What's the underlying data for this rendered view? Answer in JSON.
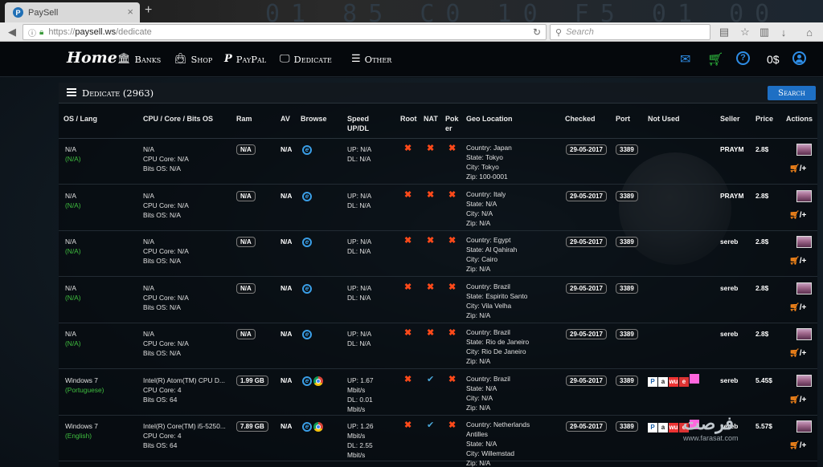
{
  "browser": {
    "tab_title": "PaySell",
    "tab_favicon": "P",
    "url_prefix": "https://",
    "url_host": "paysell.ws",
    "url_path": "/dedicate",
    "search_placeholder": "Search",
    "deco_text": "01  85  C0  10  F5  01  00  10"
  },
  "header": {
    "brand": "Home",
    "menu": [
      {
        "label": "Banks",
        "icon": "bank-icon"
      },
      {
        "label": "Shop",
        "icon": "shopping-bag-icon"
      },
      {
        "label": "PayPal",
        "icon": "paypal-icon"
      },
      {
        "label": "Dedicate",
        "icon": "monitor-icon"
      },
      {
        "label": "Other",
        "icon": "server-icon"
      }
    ],
    "balance": "0$",
    "colors": {
      "accent": "#1e6fc4",
      "mail": "#2e8de6",
      "cart": "#2fbf3f"
    }
  },
  "panel": {
    "title": "Dedicate (2963)",
    "search_button": "Search"
  },
  "table": {
    "columns": {
      "os": "OS / Lang",
      "cpu": "CPU / Core / Bits OS",
      "ram": "Ram",
      "av": "AV",
      "browse": "Browse",
      "speed1": "Speed",
      "speed2": "UP/DL",
      "root": "Root",
      "nat": "NAT",
      "poker1": "Pok",
      "poker2": "er",
      "geo": "Geo Location",
      "checked": "Checked",
      "port": "Port",
      "notused": "Not Used",
      "seller": "Seller",
      "price": "Price",
      "actions": "Actions"
    },
    "rows": [
      {
        "os": "N/A",
        "lang": "(N/A)",
        "cpu": "N/A",
        "core": "CPU Core: N/A",
        "bits": "Bits OS: N/A",
        "ram": "N/A",
        "av": "N/A",
        "up": "UP: N/A",
        "up2": "",
        "dl": "DL: N/A",
        "dl2": "",
        "nat": "x",
        "country": "Country: Japan",
        "state": "State: Tokyo",
        "city": "City: Tokyo",
        "zip": "Zip: 100-0001",
        "checked": "29-05-2017",
        "port": "3389",
        "seller": "PRAYM",
        "price": "2.8$",
        "chrome": false,
        "notused": false
      },
      {
        "os": "N/A",
        "lang": "(N/A)",
        "cpu": "N/A",
        "core": "CPU Core: N/A",
        "bits": "Bits OS: N/A",
        "ram": "N/A",
        "av": "N/A",
        "up": "UP: N/A",
        "up2": "",
        "dl": "DL: N/A",
        "dl2": "",
        "nat": "x",
        "country": "Country: Italy",
        "state": "State: N/A",
        "city": "City: N/A",
        "zip": "Zip: N/A",
        "checked": "29-05-2017",
        "port": "3389",
        "seller": "PRAYM",
        "price": "2.8$",
        "chrome": false,
        "notused": false
      },
      {
        "os": "N/A",
        "lang": "(N/A)",
        "cpu": "N/A",
        "core": "CPU Core: N/A",
        "bits": "Bits OS: N/A",
        "ram": "N/A",
        "av": "N/A",
        "up": "UP: N/A",
        "up2": "",
        "dl": "DL: N/A",
        "dl2": "",
        "nat": "x",
        "country": "Country: Egypt",
        "state": "State: Al Qahirah",
        "city": "City: Cairo",
        "zip": "Zip: N/A",
        "checked": "29-05-2017",
        "port": "3389",
        "seller": "sereb",
        "price": "2.8$",
        "chrome": false,
        "notused": false
      },
      {
        "os": "N/A",
        "lang": "(N/A)",
        "cpu": "N/A",
        "core": "CPU Core: N/A",
        "bits": "Bits OS: N/A",
        "ram": "N/A",
        "av": "N/A",
        "up": "UP: N/A",
        "up2": "",
        "dl": "DL: N/A",
        "dl2": "",
        "nat": "x",
        "country": "Country: Brazil",
        "state": "State: Espirito Santo",
        "city": "City: Vila Velha",
        "zip": "Zip: N/A",
        "checked": "29-05-2017",
        "port": "3389",
        "seller": "sereb",
        "price": "2.8$",
        "chrome": false,
        "notused": false
      },
      {
        "os": "N/A",
        "lang": "(N/A)",
        "cpu": "N/A",
        "core": "CPU Core: N/A",
        "bits": "Bits OS: N/A",
        "ram": "N/A",
        "av": "N/A",
        "up": "UP: N/A",
        "up2": "",
        "dl": "DL: N/A",
        "dl2": "",
        "nat": "x",
        "country": "Country: Brazil",
        "state": "State: Rio de Janeiro",
        "city": "City: Rio De Janeiro",
        "zip": "Zip: N/A",
        "checked": "29-05-2017",
        "port": "3389",
        "seller": "sereb",
        "price": "2.8$",
        "chrome": false,
        "notused": false
      },
      {
        "os": "Windows 7",
        "lang": "(Portuguese)",
        "cpu": "Intel(R) Atom(TM) CPU D...",
        "core": "CPU Core: 4",
        "bits": "Bits OS: 64",
        "ram": "1.99 GB",
        "av": "N/A",
        "up": "UP: 1.67",
        "up2": "Mbit/s",
        "dl": "DL: 0.01",
        "dl2": "Mbit/s",
        "nat": "check",
        "country": "Country: Brazil",
        "state": "State: N/A",
        "city": "City: N/A",
        "zip": "Zip: N/A",
        "checked": "29-05-2017",
        "port": "3389",
        "seller": "sereb",
        "price": "5.45$",
        "chrome": true,
        "notused": true
      },
      {
        "os": "Windows 7",
        "lang": "(English)",
        "cpu": "Intel(R) Core(TM) i5-5250...",
        "core": "CPU Core: 4",
        "bits": "Bits OS: 64",
        "ram": "7.89 GB",
        "av": "N/A",
        "up": "UP: 1.26",
        "up2": "Mbit/s",
        "dl": "DL: 2.55",
        "dl2": "Mbit/s",
        "nat": "check",
        "country": "Country: Netherlands",
        "state": "Antilles",
        "city": "State: N/A",
        "zip": "City: Willemstad",
        "zip2": "Zip: N/A",
        "checked": "29-05-2017",
        "port": "3389",
        "seller": "sereb",
        "price": "5.57$",
        "chrome": true,
        "notused": true
      }
    ]
  },
  "watermark": {
    "logo": "فرصت",
    "site": "www.farasat.com"
  }
}
